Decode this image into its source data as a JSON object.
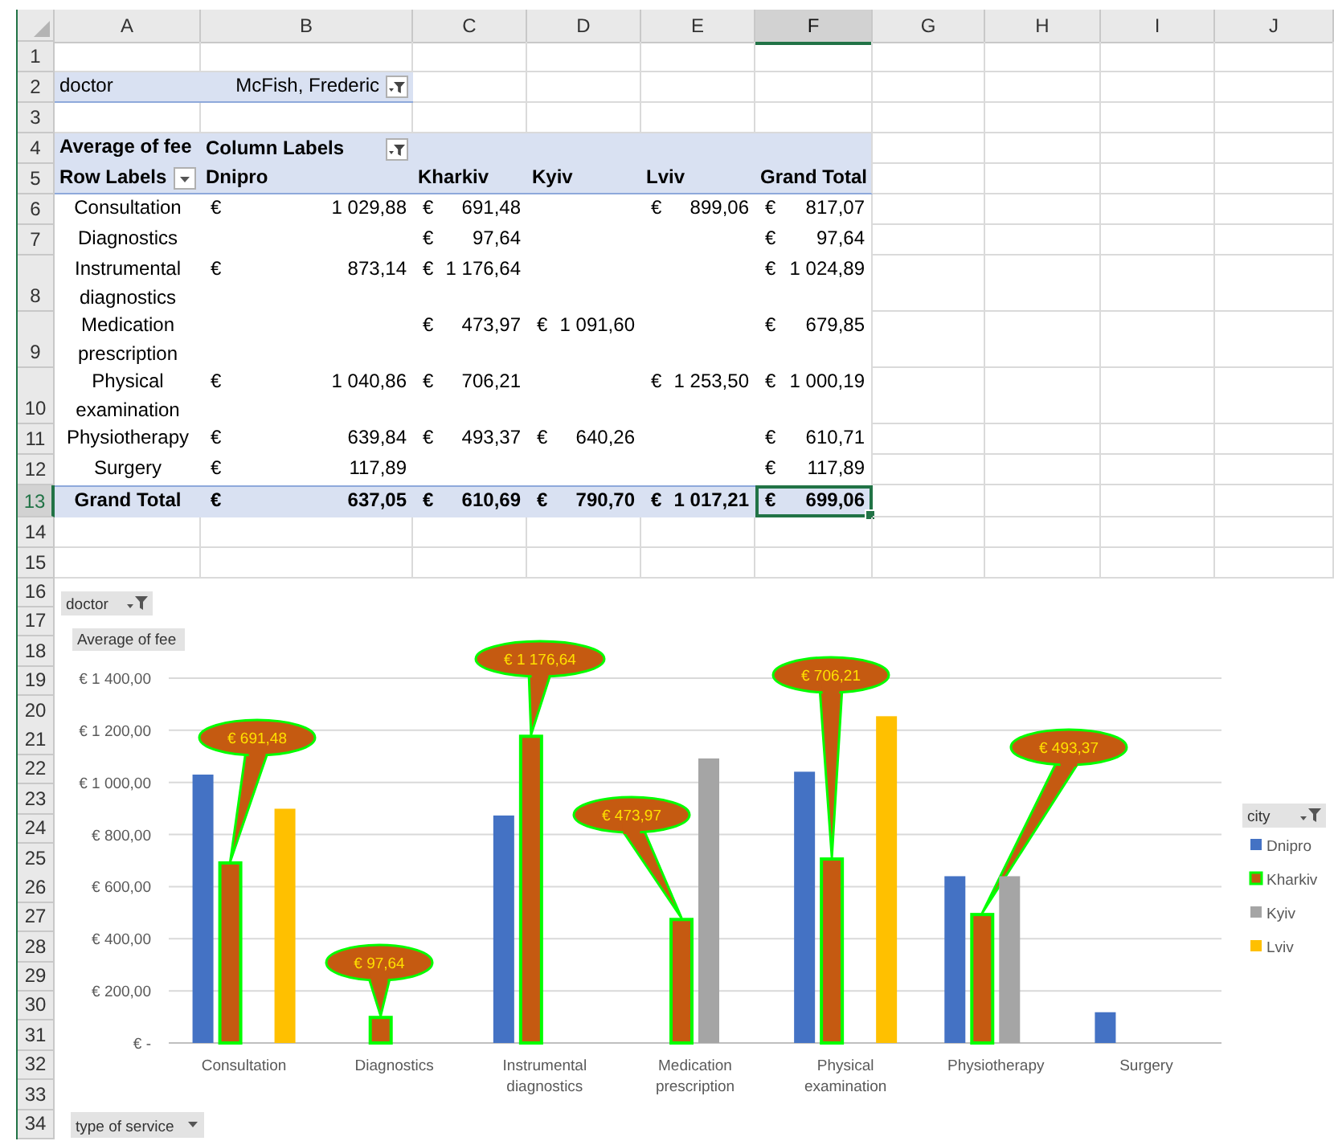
{
  "sheet": {
    "column_headers": [
      {
        "label": "A",
        "selected": false
      },
      {
        "label": "B",
        "selected": false
      },
      {
        "label": "C",
        "selected": false
      },
      {
        "label": "D",
        "selected": false
      },
      {
        "label": "E",
        "selected": false
      },
      {
        "label": "F",
        "selected": true
      },
      {
        "label": "G",
        "selected": false
      },
      {
        "label": "H",
        "selected": false
      },
      {
        "label": "I",
        "selected": false
      },
      {
        "label": "J",
        "selected": false
      }
    ],
    "row_headers": [
      {
        "label": "1",
        "selected": false
      },
      {
        "label": "2",
        "selected": false
      },
      {
        "label": "3",
        "selected": false
      },
      {
        "label": "4",
        "selected": false
      },
      {
        "label": "5",
        "selected": false
      },
      {
        "label": "6",
        "selected": false
      },
      {
        "label": "7",
        "selected": false
      },
      {
        "label": "8",
        "selected": false
      },
      {
        "label": "9",
        "selected": false
      },
      {
        "label": "10",
        "selected": false
      },
      {
        "label": "11",
        "selected": false
      },
      {
        "label": "12",
        "selected": false
      },
      {
        "label": "13",
        "selected": true
      },
      {
        "label": "14",
        "selected": false
      },
      {
        "label": "15",
        "selected": false
      },
      {
        "label": "16",
        "selected": false
      },
      {
        "label": "17",
        "selected": false
      },
      {
        "label": "18",
        "selected": false
      },
      {
        "label": "19",
        "selected": false
      },
      {
        "label": "20",
        "selected": false
      },
      {
        "label": "21",
        "selected": false
      },
      {
        "label": "22",
        "selected": false
      },
      {
        "label": "23",
        "selected": false
      },
      {
        "label": "24",
        "selected": false
      },
      {
        "label": "25",
        "selected": false
      },
      {
        "label": "26",
        "selected": false
      },
      {
        "label": "27",
        "selected": false
      },
      {
        "label": "28",
        "selected": false
      },
      {
        "label": "29",
        "selected": false
      },
      {
        "label": "30",
        "selected": false
      },
      {
        "label": "31",
        "selected": false
      },
      {
        "label": "32",
        "selected": false
      },
      {
        "label": "33",
        "selected": false
      },
      {
        "label": "34",
        "selected": false
      }
    ],
    "pivot": {
      "report_filter": {
        "field": "doctor",
        "value": "McFish, Frederic"
      },
      "value_field": "Average of fee",
      "column_labels_caption": "Column Labels",
      "row_labels_caption": "Row Labels",
      "columns": [
        "Dnipro",
        "Kharkiv",
        "Kyiv",
        "Lviv",
        "Grand Total"
      ],
      "rows": [
        {
          "label": "Consultation",
          "cells": [
            {
              "currency": "€",
              "amount": "1 029,88"
            },
            {
              "currency": "€",
              "amount": "691,48"
            },
            null,
            {
              "currency": "€",
              "amount": "899,06"
            },
            {
              "currency": "€",
              "amount": "817,07"
            }
          ]
        },
        {
          "label": "Diagnostics",
          "cells": [
            null,
            {
              "currency": "€",
              "amount": "97,64"
            },
            null,
            null,
            {
              "currency": "€",
              "amount": "97,64"
            }
          ]
        },
        {
          "label": "Instrumental diagnostics",
          "cells": [
            {
              "currency": "€",
              "amount": "873,14"
            },
            {
              "currency": "€",
              "amount": "1 176,64"
            },
            null,
            null,
            {
              "currency": "€",
              "amount": "1 024,89"
            }
          ]
        },
        {
          "label": "Medication prescription",
          "cells": [
            null,
            {
              "currency": "€",
              "amount": "473,97"
            },
            {
              "currency": "€",
              "amount": "1 091,60"
            },
            null,
            {
              "currency": "€",
              "amount": "679,85"
            }
          ]
        },
        {
          "label": "Physical examination",
          "cells": [
            {
              "currency": "€",
              "amount": "1 040,86"
            },
            {
              "currency": "€",
              "amount": "706,21"
            },
            null,
            {
              "currency": "€",
              "amount": "1 253,50"
            },
            {
              "currency": "€",
              "amount": "1 000,19"
            }
          ]
        },
        {
          "label": "Physiotherapy",
          "cells": [
            {
              "currency": "€",
              "amount": "639,84"
            },
            {
              "currency": "€",
              "amount": "493,37"
            },
            {
              "currency": "€",
              "amount": "640,26"
            },
            null,
            {
              "currency": "€",
              "amount": "610,71"
            }
          ]
        },
        {
          "label": "Surgery",
          "cells": [
            {
              "currency": "€",
              "amount": "117,89"
            },
            null,
            null,
            null,
            {
              "currency": "€",
              "amount": "117,89"
            }
          ]
        }
      ],
      "grand_total": {
        "label": "Grand Total",
        "cells": [
          {
            "currency": "€",
            "amount": "637,05",
            "selected": false
          },
          {
            "currency": "€",
            "amount": "610,69",
            "selected": false
          },
          {
            "currency": "€",
            "amount": "790,70",
            "selected": false
          },
          {
            "currency": "€",
            "amount": "1 017,21",
            "selected": false
          },
          {
            "currency": "€",
            "amount": "699,06",
            "selected": true
          }
        ]
      }
    }
  },
  "chart": {
    "report_filter_button": "doctor",
    "value_button": "Average of fee",
    "axis_field_button": "type of service",
    "legend_field_button": "city",
    "series_states": [
      {
        "selected": false
      },
      {
        "selected": true
      },
      {
        "selected": false
      },
      {
        "selected": false
      }
    ],
    "chart_data": {
      "type": "bar",
      "categories": [
        "Consultation",
        "Diagnostics",
        "Instrumental diagnostics",
        "Medication prescription",
        "Physical examination",
        "Physiotherapy",
        "Surgery"
      ],
      "series": [
        {
          "name": "Dnipro",
          "color": "#4472c4",
          "values": [
            1030,
            null,
            873,
            null,
            1041,
            640,
            118
          ]
        },
        {
          "name": "Kharkiv",
          "color": "#c55a11",
          "values": [
            691,
            98,
            1177,
            474,
            706,
            493,
            null
          ]
        },
        {
          "name": "Kyiv",
          "color": "#a5a5a5",
          "values": [
            null,
            null,
            null,
            1092,
            null,
            640,
            null
          ]
        },
        {
          "name": "Lviv",
          "color": "#ffc000",
          "values": [
            899,
            null,
            null,
            null,
            1254,
            null,
            null
          ]
        }
      ],
      "ylim": [
        0,
        1400
      ],
      "grid": true,
      "yticks": [
        {
          "value": 0,
          "label": "€ -"
        },
        {
          "value": 200,
          "label": "€ 200,00"
        },
        {
          "value": 400,
          "label": "€ 400,00"
        },
        {
          "value": 600,
          "label": "€ 600,00"
        },
        {
          "value": 800,
          "label": "€ 800,00"
        },
        {
          "value": 1000,
          "label": "€ 1 000,00"
        },
        {
          "value": 1200,
          "label": "€ 1 200,00"
        },
        {
          "value": 1400,
          "label": "€ 1 400,00"
        }
      ],
      "annotations": [
        "€ 691,48",
        "€ 97,64",
        "€ 1 176,64",
        "€ 473,97",
        "€ 706,21",
        "€ 493,37"
      ]
    }
  }
}
